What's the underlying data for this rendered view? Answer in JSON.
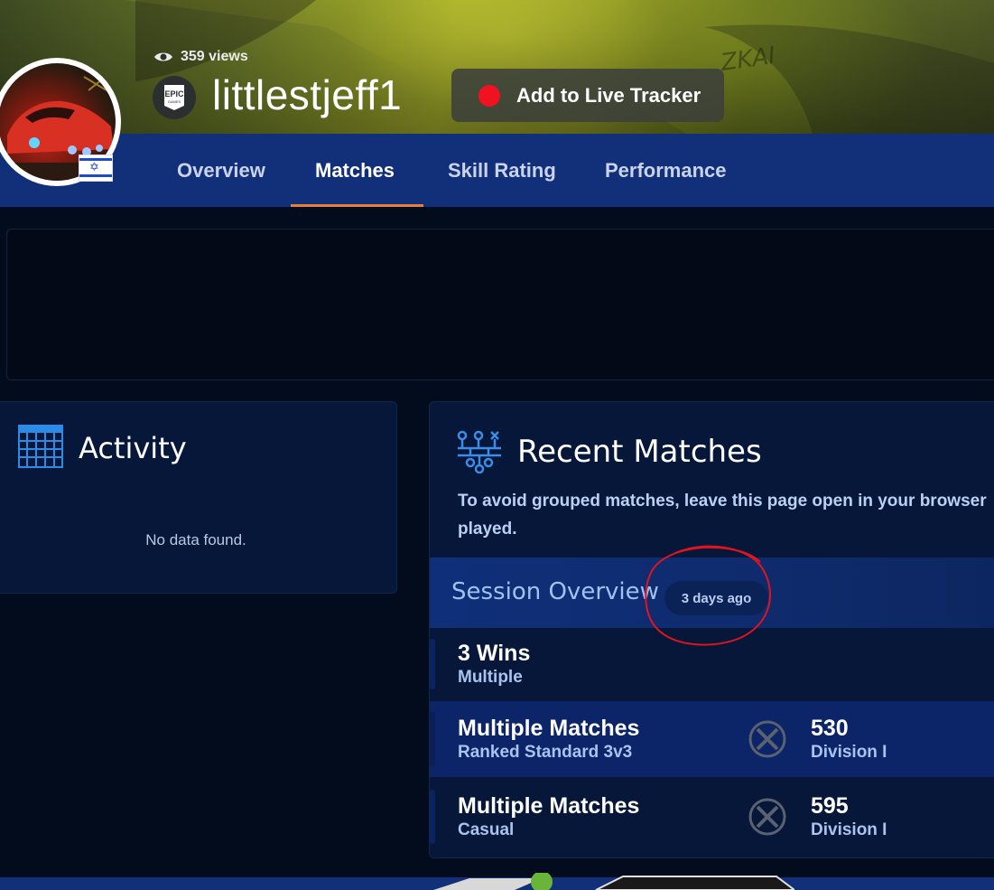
{
  "profile": {
    "views": "359 views",
    "username": "littlestjeff1",
    "platform_icon": "epic-games-icon",
    "live_tracker_label": "Add to Live Tracker",
    "flag": "israel-flag"
  },
  "nav": {
    "tabs": [
      "Overview",
      "Matches",
      "Skill Rating",
      "Performance"
    ],
    "active": "Matches"
  },
  "activity": {
    "title": "Activity",
    "empty_text": "No data found."
  },
  "recent_matches": {
    "title": "Recent Matches",
    "description": "To avoid grouped matches, leave this page open in your browser played.",
    "session": {
      "title": "Session Overview",
      "time_badge": "3 days ago"
    },
    "summary": {
      "wins": "3 Wins",
      "mode": "Multiple"
    },
    "matches": [
      {
        "title": "Multiple Matches",
        "playlist": "Ranked Standard 3v3",
        "rating": "530",
        "division": "Division I"
      },
      {
        "title": "Multiple Matches",
        "playlist": "Casual",
        "rating": "595",
        "division": "Division I"
      }
    ]
  },
  "colors": {
    "nav_bg": "#12307a",
    "page_bg": "#030c1d",
    "card_bg": "#061739",
    "active_tab_underline": "#e67f3b",
    "record_dot": "#f01221",
    "annotation": "#e0141e"
  }
}
